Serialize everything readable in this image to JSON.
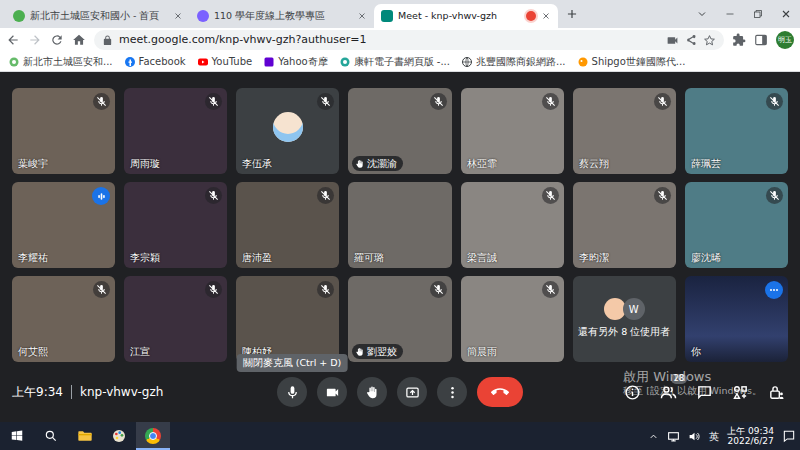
{
  "browser": {
    "tabs": [
      {
        "label": "新北市土城區安和國小 - 首頁",
        "kind": "school",
        "selected": false,
        "recording": false
      },
      {
        "label": "110 學年度線上教學專區",
        "kind": "sites",
        "selected": false,
        "recording": false
      },
      {
        "label": "Meet - knp-vhwv-gzh",
        "kind": "meet",
        "selected": true,
        "recording": true
      }
    ],
    "address": "meet.google.com/knp-vhwv-gzh?authuser=1",
    "profile": "明玉",
    "bookmarks": [
      {
        "label": "新北市土城區安和...",
        "kind": "school"
      },
      {
        "label": "Facebook",
        "kind": "facebook"
      },
      {
        "label": "YouTube",
        "kind": "youtube"
      },
      {
        "label": "Yahoo奇摩",
        "kind": "yahoo"
      },
      {
        "label": "康軒電子書網頁版 -...",
        "kind": "publisher"
      },
      {
        "label": "兆豐國際商銀網路...",
        "kind": "bank"
      },
      {
        "label": "Shipgo世鐘國際代...",
        "kind": "shipping"
      }
    ]
  },
  "meet": {
    "tiles": [
      {
        "name": "葉峻宇",
        "kind": "video",
        "muted": true,
        "hand_raised": false,
        "speaking": false
      },
      {
        "name": "周雨璇",
        "kind": "video",
        "muted": true,
        "hand_raised": false,
        "speaking": false
      },
      {
        "name": "李伍承",
        "kind": "avatar",
        "muted": true,
        "hand_raised": false,
        "speaking": false
      },
      {
        "name": "沈灝渝",
        "kind": "video",
        "muted": true,
        "hand_raised": true,
        "speaking": false
      },
      {
        "name": "林亞霏",
        "kind": "video",
        "muted": true,
        "hand_raised": false,
        "speaking": false
      },
      {
        "name": "蔡云翔",
        "kind": "video",
        "muted": true,
        "hand_raised": false,
        "speaking": false
      },
      {
        "name": "薛珮芸",
        "kind": "video",
        "muted": true,
        "hand_raised": false,
        "speaking": false
      },
      {
        "name": "李耀祐",
        "kind": "video",
        "muted": false,
        "hand_raised": false,
        "speaking": true
      },
      {
        "name": "李宗穎",
        "kind": "video",
        "muted": true,
        "hand_raised": false,
        "speaking": false
      },
      {
        "name": "唐沛盈",
        "kind": "video",
        "muted": true,
        "hand_raised": false,
        "speaking": false
      },
      {
        "name": "羅可璐",
        "kind": "video",
        "muted": false,
        "hand_raised": false,
        "speaking": false
      },
      {
        "name": "梁言誠",
        "kind": "video",
        "muted": true,
        "hand_raised": false,
        "speaking": false
      },
      {
        "name": "李昀潔",
        "kind": "video",
        "muted": true,
        "hand_raised": false,
        "speaking": false
      },
      {
        "name": "廖沈晞",
        "kind": "video",
        "muted": true,
        "hand_raised": false,
        "speaking": false
      },
      {
        "name": "何艾熙",
        "kind": "video",
        "muted": true,
        "hand_raised": false,
        "speaking": false
      },
      {
        "name": "江宣",
        "kind": "video",
        "muted": true,
        "hand_raised": false,
        "speaking": false
      },
      {
        "name": "陳柏妤",
        "kind": "video",
        "muted": true,
        "hand_raised": false,
        "speaking": false
      },
      {
        "name": "劉翌姣",
        "kind": "video",
        "muted": true,
        "hand_raised": true,
        "speaking": false
      },
      {
        "name": "簡晨雨",
        "kind": "video",
        "muted": true,
        "hand_raised": false,
        "speaking": false
      },
      {
        "name": "還有另外 8 位使用者",
        "kind": "others",
        "avatar_letter": "W",
        "muted": false,
        "hand_raised": false,
        "speaking": false
      },
      {
        "name": "你",
        "kind": "self",
        "muted": false,
        "hand_raised": false,
        "speaking": false
      }
    ],
    "time": "上午9:34",
    "code": "knp-vhwv-gzh",
    "mic_on": true,
    "camera_on": true,
    "tooltip": "關閉麥克風 (Ctrl + D)",
    "people_count": "28"
  },
  "watermark": {
    "title": "啟用 Windows",
    "subtitle": "移至 [設定] 以啟用 Windows。"
  },
  "taskbar": {
    "ime": "英",
    "time": "上午 09:34",
    "date": "2022/6/27"
  }
}
